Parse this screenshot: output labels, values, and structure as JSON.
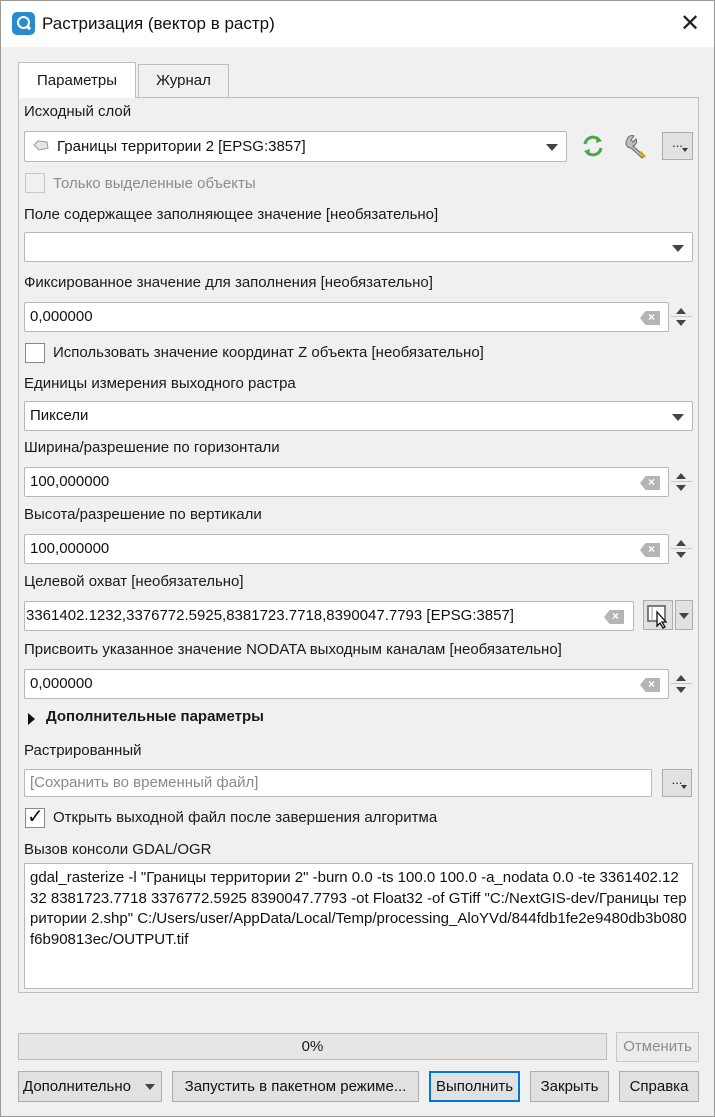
{
  "window": {
    "title": "Растризация (вектор в растр)"
  },
  "tabs": [
    {
      "label": "Параметры",
      "active": true
    },
    {
      "label": "Журнал",
      "active": false
    }
  ],
  "input_layer": {
    "label": "Исходный слой",
    "value": "Границы территории 2 [EPSG:3857]",
    "selected_only_label": "Только выделенные объекты",
    "selected_only_checked": false
  },
  "burn_field": {
    "label": "Поле содержащее заполняющее значение [необязательно]",
    "value": ""
  },
  "burn_value": {
    "label": "Фиксированное значение для заполнения [необязательно]",
    "value": "0,000000"
  },
  "use_z": {
    "label": "Использовать значение координат Z объекта [необязательно]",
    "checked": false
  },
  "units": {
    "label": "Единицы измерения выходного растра",
    "value": "Пиксели"
  },
  "width": {
    "label": "Ширина/разрешение по горизонтали",
    "value": "100,000000"
  },
  "height": {
    "label": "Высота/разрешение по вертикали",
    "value": "100,000000"
  },
  "extent": {
    "label": "Целевой охват [необязательно]",
    "value": "3361402.1232,3376772.5925,8381723.7718,8390047.7793 [EPSG:3857]"
  },
  "nodata": {
    "label": "Присвоить указанное значение NODATA выходным каналам [необязательно]",
    "value": "0,000000"
  },
  "advanced": {
    "label": "Дополнительные параметры",
    "expanded": false
  },
  "output": {
    "label": "Растрированный",
    "placeholder": "[Сохранить во временный файл]",
    "browse_label": "..."
  },
  "open_output": {
    "label": "Открыть выходной файл после завершения алгоритма",
    "checked": true
  },
  "console": {
    "label": "Вызов консоли GDAL/OGR",
    "command": "gdal_rasterize -l \"Границы территории 2\" -burn 0.0 -ts 100.0 100.0 -a_nodata 0.0 -te 3361402.1232 8381723.7718 3376772.5925 8390047.7793 -ot Float32 -of GTiff \"C:/NextGIS-dev/Границы территории 2.shp\" C:/Users/user/AppData/Local/Temp/processing_AloYVd/844fdb1fe2e9480db3b080f6b90813ec/OUTPUT.tif"
  },
  "progress": {
    "value": 0,
    "text": "0%"
  },
  "buttons": {
    "cancel": "Отменить",
    "advanced_menu": "Дополнительно",
    "batch": "Запустить в пакетном режиме...",
    "run": "Выполнить",
    "close": "Закрыть",
    "help": "Справка"
  },
  "colors": {
    "accent": "#0078d7",
    "app_icon": "#2a8ad0",
    "sync_icon": "#4aa64a"
  }
}
